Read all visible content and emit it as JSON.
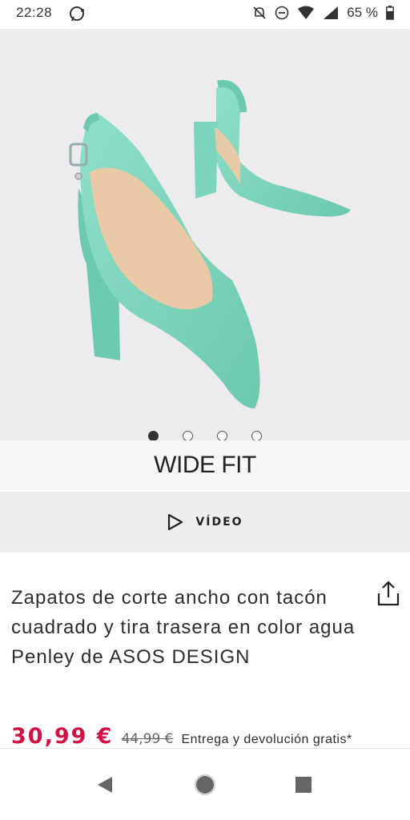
{
  "status_bar": {
    "time": "22:28",
    "battery": "65 %",
    "icons": [
      "whatsapp-icon",
      "mute-icon",
      "dnd-icon",
      "wifi-icon",
      "signal-icon",
      "battery-icon"
    ]
  },
  "product_image": {
    "alt": "Mint green slingback block-heel pumps",
    "carousel": {
      "total": 4,
      "active": 1
    }
  },
  "banner": {
    "label": "WIDE FIT"
  },
  "video": {
    "label": "VÍDEO"
  },
  "product": {
    "title": "Zapatos de corte ancho con tacón cuadrado y tira trasera en color agua Penley de ASOS DESIGN",
    "price": "30,99 €",
    "old_price": "44,99 €",
    "delivery": "Entrega y devolución gratis*"
  },
  "colors": {
    "price": "#d01345",
    "shoe": "#7fd6bd",
    "background": "#ececec"
  }
}
